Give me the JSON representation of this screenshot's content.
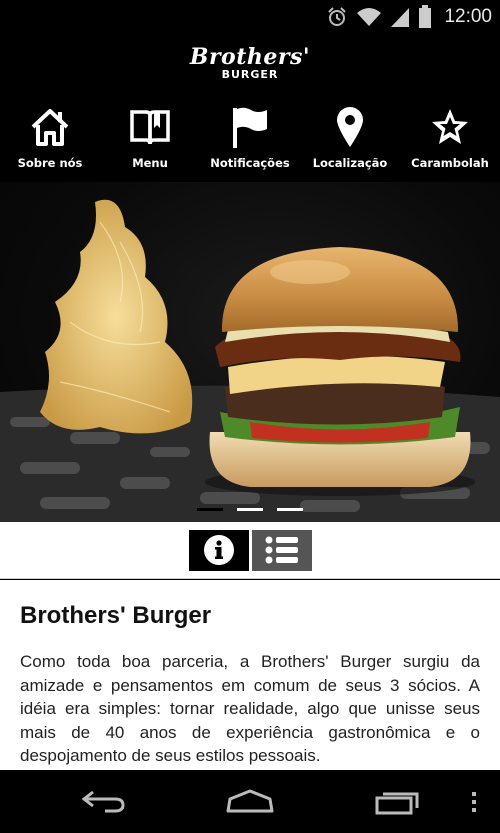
{
  "status_bar": {
    "time": "12:00",
    "icons": [
      "alarm-icon",
      "wifi-icon",
      "signal-icon",
      "battery-icon"
    ]
  },
  "header": {
    "logo_script": "Brothers'",
    "logo_sub": "BURGER"
  },
  "nav": {
    "items": [
      {
        "label": "Sobre nós",
        "icon": "home-icon"
      },
      {
        "label": "Menu",
        "icon": "book-icon"
      },
      {
        "label": "Notificações",
        "icon": "flag-icon"
      },
      {
        "label": "Localização",
        "icon": "location-pin-icon"
      },
      {
        "label": "Carambolah",
        "icon": "star-icon"
      }
    ]
  },
  "carousel": {
    "pages": 3,
    "active_page": 1
  },
  "toggle": {
    "selected": "info",
    "options": [
      "info-icon",
      "list-icon"
    ]
  },
  "content": {
    "title": "Brothers' Burger",
    "body": "Como toda boa parceria, a Brothers' Burger surgiu da amizade e pensamentos em comum de seus 3 sócios. A idéia era simples: tornar realidade, algo que unisse seus mais de 40 anos de experiência gastronômica e o despojamento de seus estilos pessoais."
  },
  "system_nav": {
    "buttons": [
      "back-icon",
      "home-icon",
      "recent-apps-icon",
      "overflow-menu-icon"
    ]
  },
  "colors": {
    "background": "#000000",
    "content_bg": "#ffffff",
    "toggle_active": "#000000",
    "toggle_inactive": "#555555"
  }
}
